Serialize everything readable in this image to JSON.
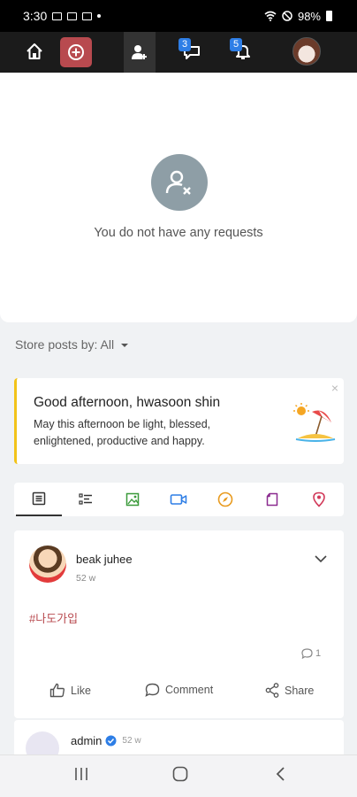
{
  "status_bar": {
    "time": "3:30",
    "battery": "98%"
  },
  "top_nav": {
    "messages_badge": "3",
    "notifications_badge": "5",
    "accent_color": "#b84a4f",
    "icons": [
      "home-icon",
      "create-post-icon",
      "friend-requests-icon",
      "messages-icon",
      "notifications-icon",
      "profile-avatar"
    ]
  },
  "requests": {
    "empty_message": "You do not have any requests"
  },
  "filter": {
    "label": "Store posts by: All"
  },
  "greeting": {
    "title": "Good afternoon, hwasoon shin",
    "body": "May this afternoon be light, blessed, enlightened, productive and happy.",
    "close": "×"
  },
  "post_tabs": {
    "icons": [
      "text-post-icon",
      "list-post-icon",
      "image-post-icon",
      "video-post-icon",
      "activity-post-icon",
      "file-post-icon",
      "location-post-icon"
    ],
    "active": "text-post-icon"
  },
  "post": {
    "author": "beak juhee",
    "time": "52 w",
    "content": "#나도가입",
    "comment_count": "1",
    "actions": {
      "like": "Like",
      "comment": "Comment",
      "share": "Share"
    }
  },
  "next_post": {
    "author": "admin",
    "time": "52 w"
  }
}
